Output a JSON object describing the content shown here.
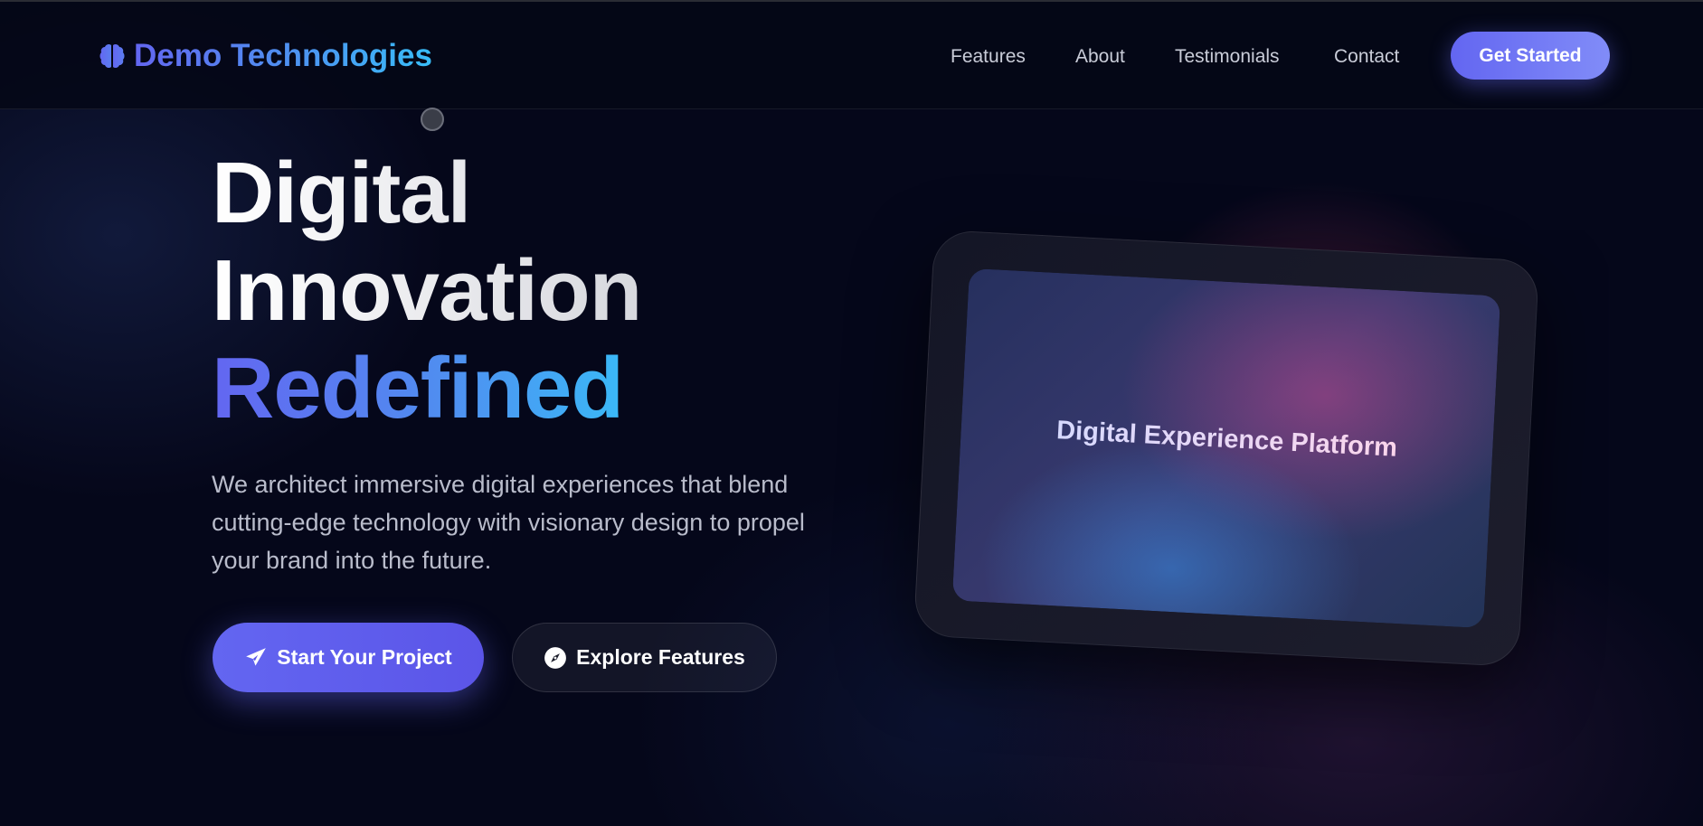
{
  "brand": {
    "name": "Demo Technologies",
    "icon": "brain-icon",
    "gradient": [
      "#6366f1",
      "#38bdf8"
    ]
  },
  "nav": {
    "links": [
      "Features",
      "About",
      "Testimonials",
      "Contact"
    ],
    "cta_label": "Get Started"
  },
  "hero": {
    "title_line1": "Digital",
    "title_line2": "Innovation",
    "title_accent": "Redefined",
    "description": "We architect immersive digital experiences that blend cutting-edge technology with visionary design to propel your brand into the future.",
    "primary_button": {
      "label": "Start Your Project",
      "icon": "paper-plane-icon"
    },
    "secondary_button": {
      "label": "Explore Features",
      "icon": "compass-icon"
    }
  },
  "device": {
    "screen_text": "Digital Experience Platform"
  },
  "colors": {
    "background": "#05071a",
    "accent": "#6366f1",
    "accent_light": "#818cf8",
    "accent_blue": "#38bdf8",
    "text_muted": "#b9bccb"
  }
}
